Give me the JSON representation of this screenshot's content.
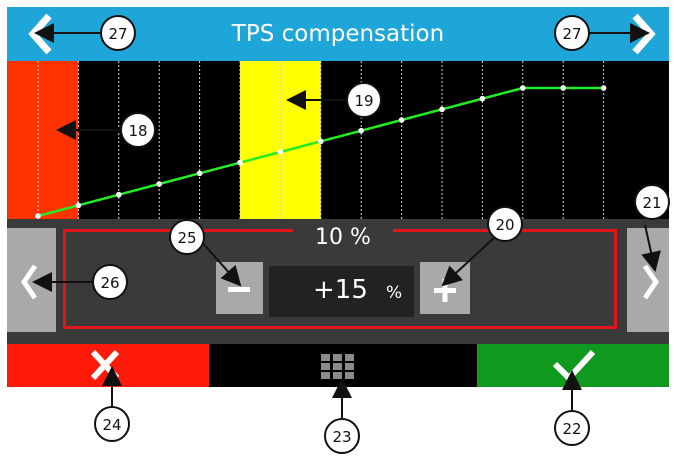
{
  "header": {
    "title": "TPS compensation"
  },
  "graph": {
    "columns": 15,
    "values": [
      0,
      5,
      10,
      15,
      20,
      25,
      30,
      35,
      40,
      45,
      50,
      55,
      60,
      60,
      60
    ],
    "value_max": 60,
    "highlight_red_columns": [
      0
    ],
    "highlight_yellow_columns": [
      6
    ],
    "colors": {
      "line": "#22ee22",
      "red_zone": "#ff3300",
      "yellow_zone": "#ffff00",
      "point": "#ffffff"
    }
  },
  "editor": {
    "column_label": "10 %",
    "value": "+15",
    "unit": "%",
    "minus": "−",
    "plus": "+"
  },
  "callouts": {
    "c18": "18",
    "c19": "19",
    "c20": "20",
    "c21": "21",
    "c22": "22",
    "c23": "23",
    "c24": "24",
    "c25": "25",
    "c26": "26",
    "c27a": "27",
    "c27b": "27"
  },
  "colors": {
    "header": "#1fa6d8",
    "cancel": "#ff1a0a",
    "ok": "#0f9a1f",
    "frame": "#e0161b"
  }
}
